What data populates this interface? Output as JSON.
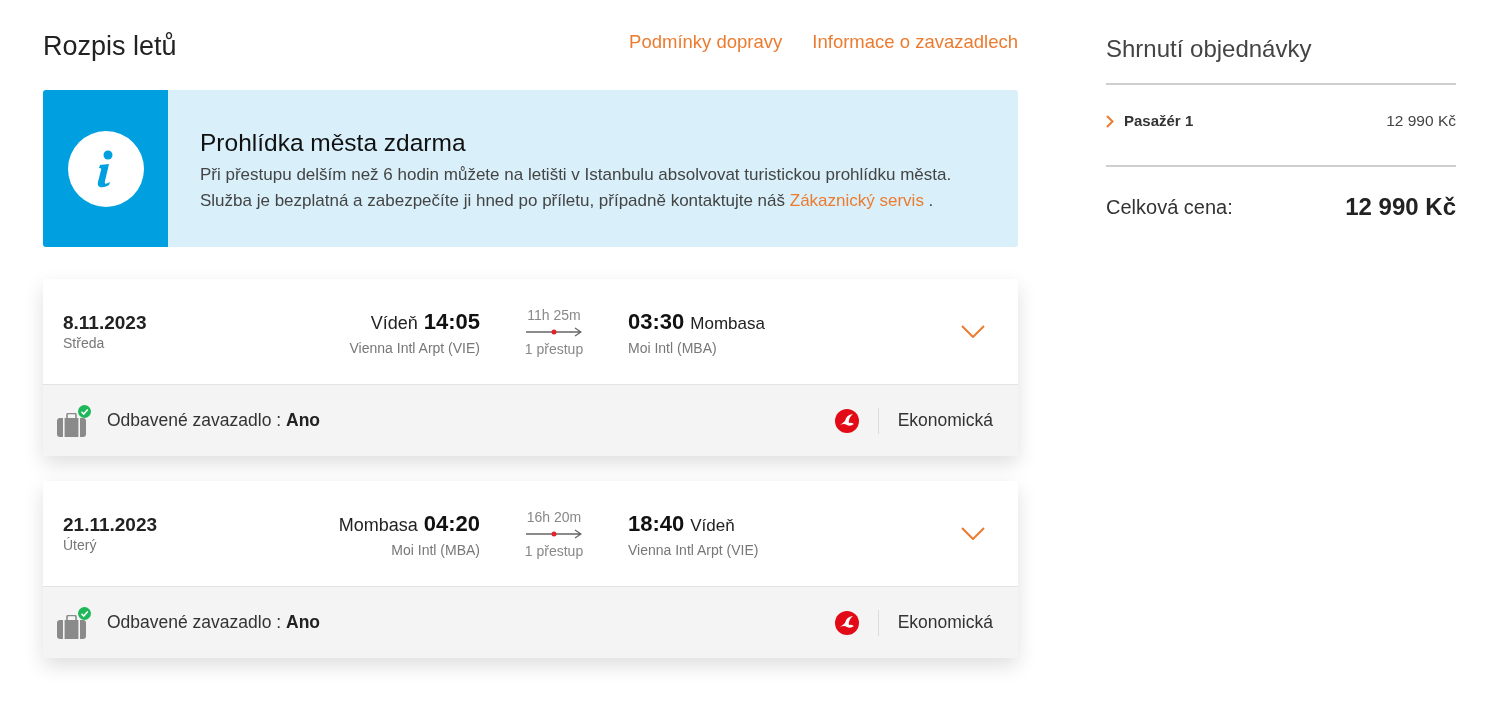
{
  "header": {
    "title": "Rozpis letů",
    "links": [
      "Podmínky dopravy",
      "Informace o zavazadlech"
    ]
  },
  "notice": {
    "title": "Prohlídka města zdarma",
    "lines": [
      "Při přestupu delším než 6 hodin můžete na letišti v Istanbulu absolvovat turistickou prohlídku města.",
      "Služba je bezplatná a zabezpečíte ji hned po příletu, případně kontaktujte náš"
    ],
    "link": "Zákaznický servis",
    "end": "."
  },
  "flights": [
    {
      "date": "8.11.2023",
      "weekday": "Středa",
      "departure": {
        "city": "Vídeň",
        "time": "14:05",
        "airport": "Vienna Intl Arpt (VIE)"
      },
      "duration": "11h 25m",
      "stops": "1 přestup",
      "arrival": {
        "time": "03:30",
        "city": "Mombasa",
        "airport": "Moi Intl (MBA)"
      },
      "expanded": false,
      "baggage": {
        "label": "Odbavené zavazadlo :",
        "value": "Ano",
        "included": true
      },
      "cabin": "Ekonomická"
    },
    {
      "date": "21.11.2023",
      "weekday": "Úterý",
      "departure": {
        "city": "Mombasa",
        "time": "04:20",
        "airport": "Moi Intl (MBA)"
      },
      "duration": "16h 20m",
      "stops": "1 přestup",
      "arrival": {
        "time": "18:40",
        "city": "Vídeň",
        "airport": "Vienna Intl Arpt (VIE)"
      },
      "expanded": false,
      "baggage": {
        "label": "Odbavené zavazadlo :",
        "value": "Ano",
        "included": true
      },
      "cabin": "Ekonomická"
    }
  ],
  "summary": {
    "title": "Shrnutí objednávky",
    "items": [
      {
        "label": "Pasažér 1",
        "price": "12 990 Kč",
        "expanded": false
      }
    ],
    "total_label": "Celková cena:",
    "total": "12 990 Kč"
  }
}
